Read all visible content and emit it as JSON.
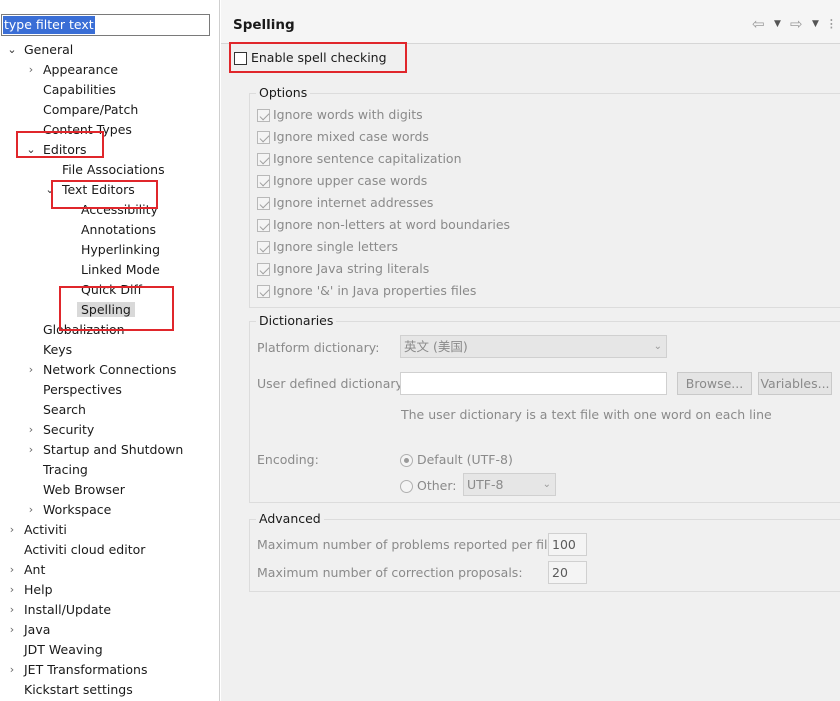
{
  "filter": {
    "text": "type filter text"
  },
  "tree": {
    "general": "General",
    "appearance": "Appearance",
    "capabilities": "Capabilities",
    "compare_patch": "Compare/Patch",
    "content_types": "Content Types",
    "editors": "Editors",
    "file_associations": "File Associations",
    "text_editors": "Text Editors",
    "accessibility": "Accessibility",
    "annotations": "Annotations",
    "hyperlinking": "Hyperlinking",
    "linked_mode": "Linked Mode",
    "quick_diff": "Quick Diff",
    "spelling": "Spelling",
    "globalization": "Globalization",
    "keys": "Keys",
    "network_connections": "Network Connections",
    "perspectives": "Perspectives",
    "search": "Search",
    "security": "Security",
    "startup_shutdown": "Startup and Shutdown",
    "tracing": "Tracing",
    "web_browser": "Web Browser",
    "workspace": "Workspace",
    "activiti": "Activiti",
    "activiti_cloud_editor": "Activiti cloud editor",
    "ant": "Ant",
    "help": "Help",
    "install_update": "Install/Update",
    "java": "Java",
    "jdt_weaving": "JDT Weaving",
    "jet_transformations": "JET Transformations",
    "kickstart_settings": "Kickstart settings"
  },
  "page": {
    "title": "Spelling",
    "enable_label": "Enable spell checking",
    "enable_checked": false,
    "options_title": "Options",
    "options": [
      "Ignore words with digits",
      "Ignore mixed case words",
      "Ignore sentence capitalization",
      "Ignore upper case words",
      "Ignore internet addresses",
      "Ignore non-letters at word boundaries",
      "Ignore single letters",
      "Ignore Java string literals",
      "Ignore '&' in Java properties files"
    ],
    "dictionaries_title": "Dictionaries",
    "platform_dictionary_label": "Platform dictionary:",
    "platform_dictionary_value": "英文 (美国)",
    "user_dictionary_label": "User defined dictionary:",
    "browse_label": "Browse...",
    "variables_label": "Variables...",
    "user_dictionary_hint": "The user dictionary is a text file with one word on each line",
    "encoding_label": "Encoding:",
    "encoding_default": "Default (UTF-8)",
    "encoding_other": "Other:",
    "encoding_other_value": "UTF-8",
    "advanced_title": "Advanced",
    "max_problems_label": "Maximum number of problems reported per file:",
    "max_problems_value": "100",
    "max_proposals_label": "Maximum number of correction proposals:",
    "max_proposals_value": "20"
  },
  "icons": {
    "back": "arrow-left-icon",
    "forward": "arrow-right-icon",
    "dropdown": "chevron-down-icon"
  },
  "colors": {
    "annotation_red": "#e0262b",
    "selection_blue": "#3a6ed6"
  }
}
